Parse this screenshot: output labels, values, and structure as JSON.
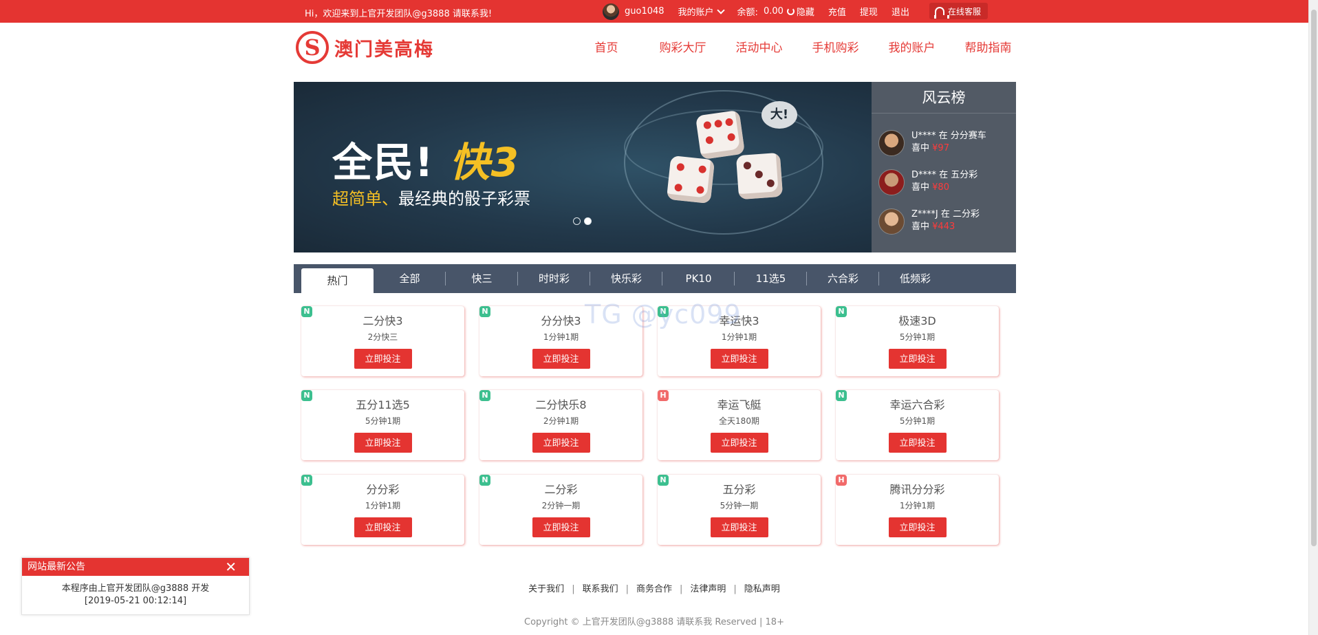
{
  "topbar": {
    "welcome": "Hi，欢迎来到上官开发团队@g3888 请联系我!",
    "username": "guo1048",
    "my_account": "我的账户",
    "balance_label": "余额:",
    "balance_value": "0.00",
    "hide": "隐藏",
    "recharge": "充值",
    "withdraw": "提现",
    "logout": "退出",
    "service": "在线客服"
  },
  "header": {
    "logo_text": "澳门美高梅",
    "nav": [
      "首页",
      "购彩大厅",
      "活动中心",
      "手机购彩",
      "我的账户",
      "帮助指南"
    ]
  },
  "banner": {
    "headline_a": "全民!",
    "headline_b": "快3",
    "sub_a": "超简单、",
    "sub_b": "最经典的骰子彩票",
    "bubble": "大!"
  },
  "leaderboard": {
    "title": "风云榜",
    "entries": [
      {
        "line1": "U**** 在 分分赛车",
        "prefix": "喜中",
        "amount": "¥97"
      },
      {
        "line1": "D**** 在 五分彩",
        "prefix": "喜中",
        "amount": "¥80"
      },
      {
        "line1": "Z****J 在 二分彩",
        "prefix": "喜中",
        "amount": "¥443"
      }
    ]
  },
  "tabs": [
    "热门",
    "全部",
    "快三",
    "时时彩",
    "快乐彩",
    "PK10",
    "11选5",
    "六合彩",
    "低频彩"
  ],
  "games": [
    {
      "badge": "N",
      "name": "二分快3",
      "period": "2分快三",
      "button": "立即投注"
    },
    {
      "badge": "N",
      "name": "分分快3",
      "period": "1分钟1期",
      "button": "立即投注"
    },
    {
      "badge": "N",
      "name": "幸运快3",
      "period": "1分钟1期",
      "button": "立即投注"
    },
    {
      "badge": "N",
      "name": "极速3D",
      "period": "5分钟1期",
      "button": "立即投注"
    },
    {
      "badge": "N",
      "name": "五分11选5",
      "period": "5分钟1期",
      "button": "立即投注"
    },
    {
      "badge": "N",
      "name": "二分快乐8",
      "period": "2分钟1期",
      "button": "立即投注"
    },
    {
      "badge": "H",
      "name": "幸运飞艇",
      "period": "全天180期",
      "button": "立即投注"
    },
    {
      "badge": "N",
      "name": "幸运六合彩",
      "period": "5分钟1期",
      "button": "立即投注"
    },
    {
      "badge": "N",
      "name": "分分彩",
      "period": "1分钟1期",
      "button": "立即投注"
    },
    {
      "badge": "N",
      "name": "二分彩",
      "period": "2分钟一期",
      "button": "立即投注"
    },
    {
      "badge": "N",
      "name": "五分彩",
      "period": "5分钟一期",
      "button": "立即投注"
    },
    {
      "badge": "H",
      "name": "腾讯分分彩",
      "period": "1分钟1期",
      "button": "立即投注"
    }
  ],
  "watermark": "TG @yc099",
  "footer": {
    "links": [
      "关于我们",
      "联系我们",
      "商务合作",
      "法律声明",
      "隐私声明"
    ],
    "copyright": "Copyright © 上官开发团队@g3888 请联系我 Reserved | 18+"
  },
  "notice": {
    "title": "网站最新公告",
    "close": "✕",
    "line1": "本程序由上官开发团队@g3888 开发",
    "line2": "[2019-05-21 00:12:14]"
  },
  "colors": {
    "brand_red": "#e43431",
    "tab_bar": "#485569",
    "leaderboard_bg": "#525a65",
    "badge_new": "#3cbf8f",
    "badge_hot": "#f16a6a"
  }
}
